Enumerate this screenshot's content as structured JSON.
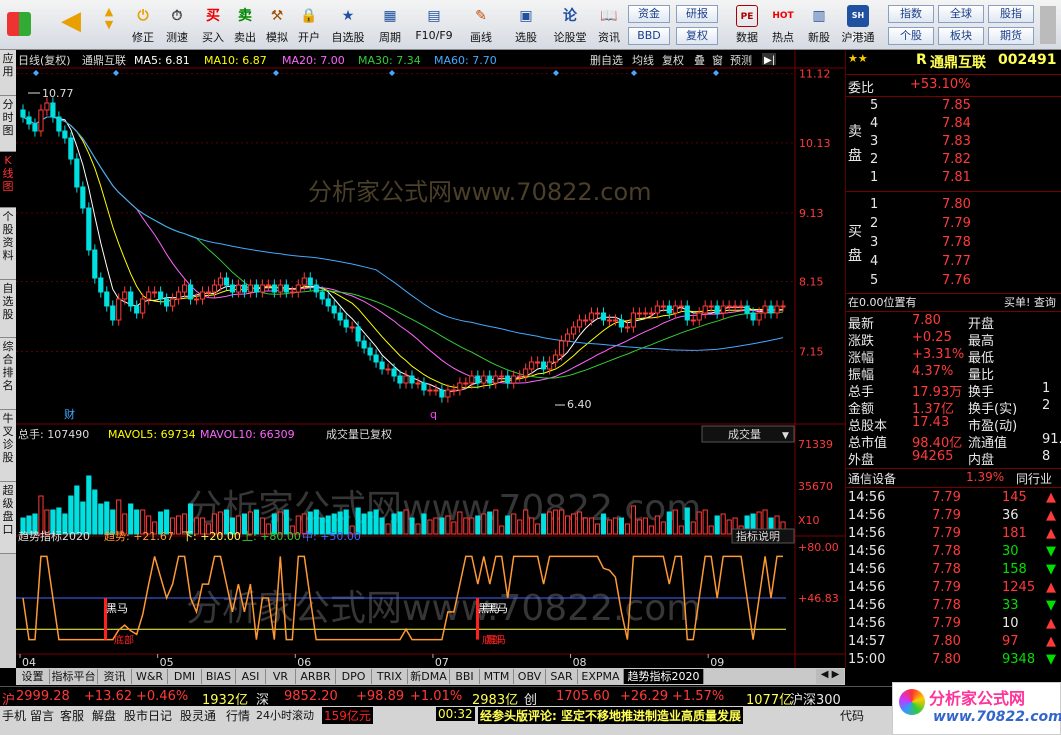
{
  "toolbar": {
    "buttons": [
      "买入",
      "卖出",
      "模拟",
      "开户",
      "自选股",
      "周期",
      "F10/F9",
      "画线",
      "选股",
      "论股堂",
      "资讯",
      "数据",
      "热点",
      "新股",
      "沪港通"
    ],
    "nav_buttons": [
      "修正",
      "测速"
    ],
    "small_buttons": [
      "资金",
      "研报",
      "BBD",
      "复权"
    ],
    "right_buttons": [
      "指数",
      "全球",
      "股指",
      "个股",
      "板块",
      "期货"
    ]
  },
  "left_tabs": [
    "应用",
    "分时图",
    "K线图",
    "个股资料",
    "自选股",
    "综合排名",
    "牛叉诊股",
    "超级盘口"
  ],
  "chart": {
    "header": {
      "title": "日线(复权)",
      "name": "通鼎互联",
      "ma5": "MA5: 6.81",
      "ma10": "MA10: 6.87",
      "ma20": "MA20: 7.00",
      "ma30": "MA30: 7.34",
      "ma60": "MA60: 7.70",
      "right_tools": [
        "删自选",
        "均线",
        "复权",
        "叠",
        "窗",
        "预测"
      ]
    },
    "price_axis": [
      "11.12",
      "10.13",
      "9.13",
      "8.15",
      "7.15"
    ],
    "high_label": "10.77",
    "low_label": "6.40",
    "marks": [
      "财",
      "q"
    ],
    "watermark": "分析家公式网www.70822.com",
    "volume": {
      "header": "总手: 107490",
      "mavol5": "MAVOL5: 69734",
      "mavol10": "MAVOL10: 66309",
      "note": "成交量已复权",
      "selector": "成交量",
      "axis": [
        "71339",
        "35670",
        "X10"
      ]
    },
    "indicator": {
      "name": "趋势指标2020",
      "trend": "趋势: +21.67",
      "down": "下: +20.00",
      "up": "上: +80.00",
      "mid": "中: +50.00",
      "explain": "指标说明",
      "axis": [
        "+80.00",
        "+46.83"
      ],
      "labels": [
        "黑马",
        "底部",
        "底部",
        "黑马",
        "黑马",
        "底部"
      ]
    },
    "date_axis": [
      "04",
      "05",
      "06",
      "07",
      "08",
      "09"
    ],
    "chart_data": {
      "type": "candlestick",
      "title": "通鼎互联 日线(复权)",
      "ylim": [
        6.2,
        11.2
      ],
      "x": [
        "04",
        "",
        "",
        "",
        "",
        "",
        "",
        "",
        "",
        "",
        "",
        "",
        "",
        "",
        "",
        "",
        "",
        "",
        "",
        "",
        "",
        "",
        "",
        "05",
        "",
        "",
        "",
        "",
        "",
        "",
        "",
        "",
        "",
        "",
        "",
        "",
        "",
        "",
        "",
        "",
        "",
        "",
        "",
        "",
        "",
        "",
        "06",
        "",
        "",
        "",
        "",
        "",
        "",
        "",
        "",
        "",
        "",
        "",
        "",
        "",
        "",
        "",
        "",
        "",
        "",
        "",
        "",
        "",
        "",
        "07",
        "",
        "",
        "",
        "",
        "",
        "",
        "",
        "",
        "",
        "",
        "",
        "",
        "",
        "",
        "",
        "",
        "",
        "",
        "",
        "",
        "",
        "",
        "08",
        "",
        "",
        "",
        "",
        "",
        "",
        "",
        "",
        "",
        "",
        "",
        "",
        "",
        "",
        "",
        "",
        "",
        "",
        "",
        "",
        "",
        "",
        "09",
        "",
        "",
        "",
        "",
        "",
        "",
        "",
        "",
        "",
        ""
      ],
      "open": [
        10.6,
        10.5,
        10.4,
        10.3,
        10.6,
        10.7,
        10.5,
        10.3,
        10.2,
        9.9,
        9.5,
        9.2,
        8.6,
        8.2,
        8.0,
        7.8,
        7.6,
        7.9,
        8.0,
        7.8,
        7.7,
        7.9,
        8.0,
        8.0,
        7.9,
        7.8,
        7.9,
        8.0,
        8.1,
        7.9,
        7.9,
        8.0,
        8.0,
        8.1,
        8.2,
        8.1,
        8.0,
        8.1,
        8.0,
        8.1,
        8.0,
        8.1,
        8.1,
        8.0,
        8.1,
        8.0,
        8.0,
        8.1,
        8.2,
        8.1,
        8.0,
        7.9,
        7.8,
        7.7,
        7.6,
        7.5,
        7.5,
        7.3,
        7.2,
        7.1,
        7.0,
        6.9,
        6.9,
        6.8,
        6.7,
        6.8,
        6.7,
        6.7,
        6.6,
        6.6,
        6.6,
        6.5,
        6.6,
        6.6,
        6.7,
        6.7,
        6.8,
        6.7,
        6.8,
        6.7,
        6.8,
        6.8,
        6.7,
        6.8,
        6.8,
        6.9,
        7.0,
        7.0,
        6.9,
        7.0,
        7.1,
        7.3,
        7.4,
        7.5,
        7.6,
        7.6,
        7.7,
        7.7,
        7.6,
        7.6,
        7.6,
        7.5,
        7.5,
        7.7,
        7.7,
        7.7,
        7.7,
        7.8,
        7.8,
        7.7,
        7.8,
        7.8,
        7.6,
        7.6,
        7.7,
        7.8,
        7.8,
        7.7,
        7.8,
        7.8,
        7.8,
        7.8,
        7.7,
        7.6,
        7.7,
        7.8,
        7.7,
        7.8
      ],
      "close": [
        10.5,
        10.4,
        10.3,
        10.6,
        10.7,
        10.5,
        10.3,
        10.2,
        9.9,
        9.5,
        9.2,
        8.6,
        8.2,
        8.0,
        7.8,
        7.6,
        7.9,
        8.0,
        7.8,
        7.7,
        7.9,
        8.0,
        8.0,
        7.9,
        7.8,
        7.9,
        8.0,
        8.1,
        7.9,
        7.9,
        8.0,
        8.0,
        8.1,
        8.2,
        8.1,
        8.0,
        8.1,
        8.0,
        8.1,
        8.0,
        8.1,
        8.1,
        8.0,
        8.1,
        8.0,
        8.0,
        8.1,
        8.2,
        8.1,
        8.0,
        7.9,
        7.8,
        7.7,
        7.6,
        7.5,
        7.5,
        7.3,
        7.2,
        7.1,
        7.0,
        6.9,
        6.9,
        6.8,
        6.7,
        6.8,
        6.7,
        6.7,
        6.6,
        6.6,
        6.6,
        6.5,
        6.6,
        6.6,
        6.7,
        6.7,
        6.8,
        6.7,
        6.8,
        6.7,
        6.8,
        6.8,
        6.7,
        6.8,
        6.8,
        6.9,
        7.0,
        7.0,
        6.9,
        7.0,
        7.1,
        7.3,
        7.4,
        7.5,
        7.6,
        7.6,
        7.7,
        7.7,
        7.6,
        7.6,
        7.6,
        7.5,
        7.5,
        7.7,
        7.7,
        7.7,
        7.7,
        7.8,
        7.8,
        7.7,
        7.8,
        7.8,
        7.6,
        7.6,
        7.7,
        7.8,
        7.8,
        7.7,
        7.8,
        7.8,
        7.8,
        7.8,
        7.7,
        7.6,
        7.7,
        7.8,
        7.7,
        7.8,
        7.8
      ]
    }
  },
  "right_panel": {
    "code_prefix": "R",
    "stock_name": "通鼎互联",
    "stock_code": "002491",
    "weibi_label": "委比",
    "weibi_value": "+53.10%",
    "sell_label": "卖盘",
    "buy_label": "买盘",
    "sell": [
      [
        "5",
        "7.85"
      ],
      [
        "4",
        "7.84"
      ],
      [
        "3",
        "7.83"
      ],
      [
        "2",
        "7.82"
      ],
      [
        "1",
        "7.81"
      ]
    ],
    "buy": [
      [
        "1",
        "7.80"
      ],
      [
        "2",
        "7.79"
      ],
      [
        "3",
        "7.78"
      ],
      [
        "4",
        "7.77"
      ],
      [
        "5",
        "7.76"
      ]
    ],
    "position_text": "在0.00位置有",
    "position_right": "买单! 查询",
    "quote_rows": [
      [
        "最新",
        "7.80",
        "开盘",
        ""
      ],
      [
        "涨跌",
        "+0.25",
        "最高",
        ""
      ],
      [
        "涨幅",
        "+3.31%",
        "最低",
        ""
      ],
      [
        "振幅",
        "4.37%",
        "量比",
        ""
      ],
      [
        "总手",
        "17.93万",
        "换手",
        "1"
      ],
      [
        "金额",
        "1.37亿",
        "换手(实)",
        "2"
      ],
      [
        "总股本",
        "17.43",
        "市盈(动)",
        ""
      ],
      [
        "总市值",
        "98.40亿",
        "流通值",
        "91."
      ],
      [
        "外盘",
        "94265",
        "内盘",
        "8"
      ]
    ],
    "industry": "通信设备",
    "industry_pct": "1.39%",
    "industry_right": "同行业",
    "ticks": [
      [
        "14:56",
        "7.79",
        "145",
        "up"
      ],
      [
        "14:56",
        "7.79",
        "36",
        "up"
      ],
      [
        "14:56",
        "7.79",
        "181",
        "up"
      ],
      [
        "14:56",
        "7.78",
        "30",
        "down"
      ],
      [
        "14:56",
        "7.78",
        "158",
        "down"
      ],
      [
        "14:56",
        "7.79",
        "1245",
        "up"
      ],
      [
        "14:56",
        "7.78",
        "33",
        "down"
      ],
      [
        "14:56",
        "7.79",
        "10",
        "up"
      ],
      [
        "14:57",
        "7.80",
        "97",
        "up"
      ],
      [
        "15:00",
        "7.80",
        "9348",
        "down"
      ]
    ]
  },
  "bottom_tabs": [
    "设置",
    "指标平台",
    "资讯",
    "W&R",
    "DMI",
    "BIAS",
    "ASI",
    "VR",
    "ARBR",
    "DPO",
    "TRIX",
    "新DMA",
    "BBI",
    "MTM",
    "OBV",
    "SAR",
    "EXPMA",
    "趋势指标2020"
  ],
  "status_bar": {
    "sh": "沪",
    "sh_index": "2999.28",
    "sh_change": "+13.62",
    "sh_pct": "+0.46%",
    "sh_amount": "1932亿",
    "sz": "深",
    "sz_index": "9852.20",
    "sz_change": "+98.89",
    "sz_pct": "+1.01%",
    "sz_amount": "2983亿",
    "cy": "创",
    "cy_index": "1705.60",
    "cy_change": "+26.29",
    "cy_pct": "+1.57%",
    "hs_amount": "1077亿",
    "hs": "沪深300"
  },
  "status_bar2": {
    "items": [
      "手机",
      "留言",
      "客服",
      "解盘",
      "股市日记",
      "股灵通",
      "行情",
      "24小时滚动"
    ],
    "money": "159亿元",
    "news_time": "00:32",
    "news": "经参头版评论: 坚定不移地推进制造业高质量发展",
    "right": "代码"
  },
  "logo": {
    "text": "分析家公式网",
    "url": "www.70822.com"
  },
  "colors": {
    "up": "#ff3a3a",
    "down": "#00e0e0",
    "ma5": "#ffffff",
    "ma10": "#ffff00",
    "ma20": "#ff66ff",
    "ma30": "#33cc33",
    "ma60": "#44aaff"
  }
}
